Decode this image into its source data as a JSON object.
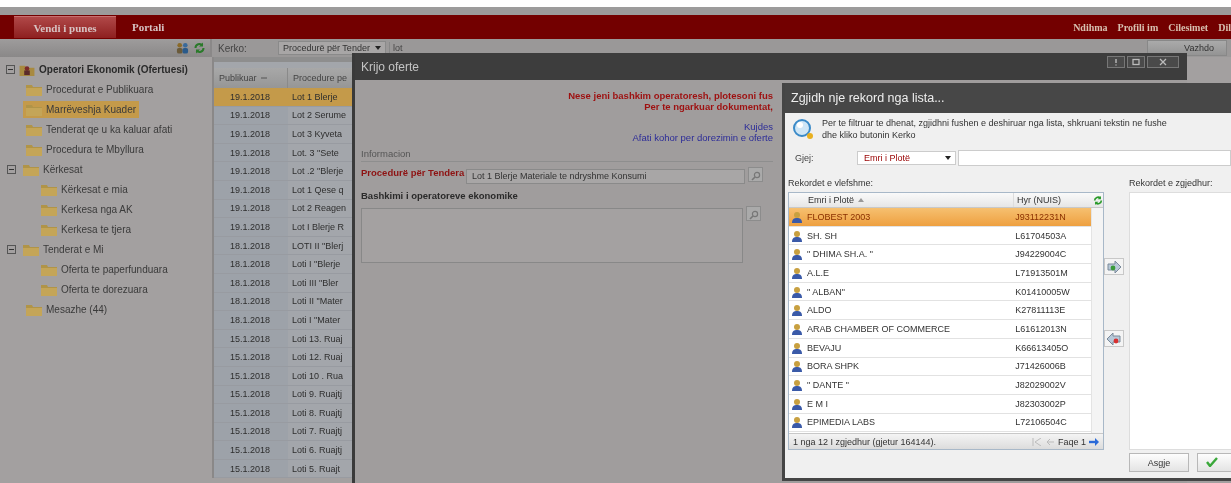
{
  "top_nav": {
    "tabs": [
      {
        "label": "Vendi i punes",
        "selected": true
      },
      {
        "label": "Portali",
        "selected": false
      }
    ],
    "links": [
      "Ndihma",
      "Profili im",
      "Cilesimet",
      "Dil"
    ]
  },
  "toolbar": {
    "search_label": "Kerko:",
    "search_field": "Procedurë për Tender",
    "search_value": "lot",
    "continue_button": "Vazhdo"
  },
  "tree": {
    "label": "Operatori Ekonomik (Ofertuesi)",
    "expanded": true,
    "children": [
      {
        "label": "Procedurat e Publikuara",
        "selected": false
      },
      {
        "label": "Marrëveshja Kuader",
        "selected": true
      },
      {
        "label": "Tenderat qe u ka kaluar afati",
        "selected": false
      },
      {
        "label": "Procedura te Mbyllura",
        "selected": false
      },
      {
        "label": "Kërkesat",
        "selected": false,
        "expanded": true,
        "children": [
          {
            "label": "Kërkesat e mia",
            "selected": false
          },
          {
            "label": "Kerkesa nga AK",
            "selected": false
          },
          {
            "label": "Kerkesa te tjera",
            "selected": false
          }
        ]
      },
      {
        "label": "Tenderat e Mi",
        "selected": false,
        "expanded": true,
        "children": [
          {
            "label": "Oferta te paperfunduara",
            "selected": false
          },
          {
            "label": "Oferta te dorezuara",
            "selected": false
          }
        ]
      },
      {
        "label": "Mesazhe (44)",
        "selected": false
      }
    ]
  },
  "grid": {
    "columns": [
      "Publikuar",
      "Procedure pe"
    ],
    "rows": [
      {
        "date": "19.1.2018",
        "procedure": "Lot 1 Blerje",
        "selected": true
      },
      {
        "date": "19.1.2018",
        "procedure": "Lot 2 Serume",
        "selected": false
      },
      {
        "date": "19.1.2018",
        "procedure": "Lot 3 Kyveta",
        "selected": false
      },
      {
        "date": "19.1.2018",
        "procedure": "Lot. 3 \"Sete",
        "selected": false
      },
      {
        "date": "19.1.2018",
        "procedure": "Lot .2 \"Blerje",
        "selected": false
      },
      {
        "date": "19.1.2018",
        "procedure": "Lot 1 Qese q",
        "selected": false
      },
      {
        "date": "19.1.2018",
        "procedure": "Lot 2 Reagen",
        "selected": false
      },
      {
        "date": "19.1.2018",
        "procedure": "Lot I Blerje R",
        "selected": false
      },
      {
        "date": "18.1.2018",
        "procedure": "LOTI II \"Blerj",
        "selected": false
      },
      {
        "date": "18.1.2018",
        "procedure": "Loti I \"Blerje",
        "selected": false
      },
      {
        "date": "18.1.2018",
        "procedure": "Loti III \"Bler",
        "selected": false
      },
      {
        "date": "18.1.2018",
        "procedure": "Loti II \"Mater",
        "selected": false
      },
      {
        "date": "18.1.2018",
        "procedure": "Loti I \"Mater",
        "selected": false
      },
      {
        "date": "15.1.2018",
        "procedure": "Loti 13. Ruaj",
        "selected": false
      },
      {
        "date": "15.1.2018",
        "procedure": "Loti 12. Ruaj",
        "selected": false
      },
      {
        "date": "15.1.2018",
        "procedure": "Loti 10 . Rua",
        "selected": false
      },
      {
        "date": "15.1.2018",
        "procedure": "Loti 9. Ruajtj",
        "selected": false
      },
      {
        "date": "15.1.2018",
        "procedure": "Loti 8. Ruajtj",
        "selected": false
      },
      {
        "date": "15.1.2018",
        "procedure": "Loti 7. Ruajtj",
        "selected": false
      },
      {
        "date": "15.1.2018",
        "procedure": "Loti 6. Ruajtj",
        "selected": false
      },
      {
        "date": "15.1.2018",
        "procedure": "Loti 5. Ruajt",
        "selected": false
      }
    ]
  },
  "offer_dialog": {
    "title": "Krijo oferte",
    "notices": [
      "Nese jeni bashkim operatoresh, plotesoni fus",
      "Per te ngarkuar dokumentat,"
    ],
    "warnings": [
      "Kujdes",
      "Afati kohor per dorezimin e oferte"
    ],
    "section": "Informacion",
    "procedure_label": "Procedurë për Tendera",
    "procedure_value": "Lot 1 Blerje Materiale te ndryshme Konsumi",
    "consortium_label": "Bashkimi i operatoreve ekonomike"
  },
  "picker_dialog": {
    "title": "Zgjidh nje rekord nga lista...",
    "hint": [
      "Per te filtruar te dhenat, zgjidhni fushen e deshiruar nga lista, shkruani tekstin ne fushe",
      "dhe kliko butonin Kerko"
    ],
    "find_label": "Gjej:",
    "find_field": "Emri i Plotë",
    "available_label": "Rekordet e vlefshme:",
    "selected_label": "Rekordet e zgjedhur:",
    "columns": [
      "Emri i Plotë",
      "Hyr (NUIS)"
    ],
    "rows": [
      {
        "name": "FLOBEST 2003",
        "nuis": "J93112231N",
        "selected": true
      },
      {
        "name": "SH. SH",
        "nuis": "L61704503A",
        "selected": false
      },
      {
        "name": "\" DHIMA SH.A. \"",
        "nuis": "J94229004C",
        "selected": false
      },
      {
        "name": "A.L.E",
        "nuis": "L71913501M",
        "selected": false
      },
      {
        "name": "\" ALBAN\"",
        "nuis": "K01410005W",
        "selected": false
      },
      {
        "name": "ALDO",
        "nuis": "K27811113E",
        "selected": false
      },
      {
        "name": "ARAB CHAMBER OF COMMERCE",
        "nuis": "L61612013N",
        "selected": false
      },
      {
        "name": "BEVAJU",
        "nuis": "K66613405O",
        "selected": false
      },
      {
        "name": "BORA SHPK",
        "nuis": "J71426006B",
        "selected": false
      },
      {
        "name": "\" DANTE \"",
        "nuis": "J82029002V",
        "selected": false
      },
      {
        "name": "E M I",
        "nuis": "J82303002P",
        "selected": false
      },
      {
        "name": "EPIMEDIA LABS",
        "nuis": "L72106504C",
        "selected": false
      }
    ],
    "status": "1 nga 12 I zgjedhur (gjetur 164144).",
    "page": "Faqe 1",
    "none_button": "Asgje"
  }
}
